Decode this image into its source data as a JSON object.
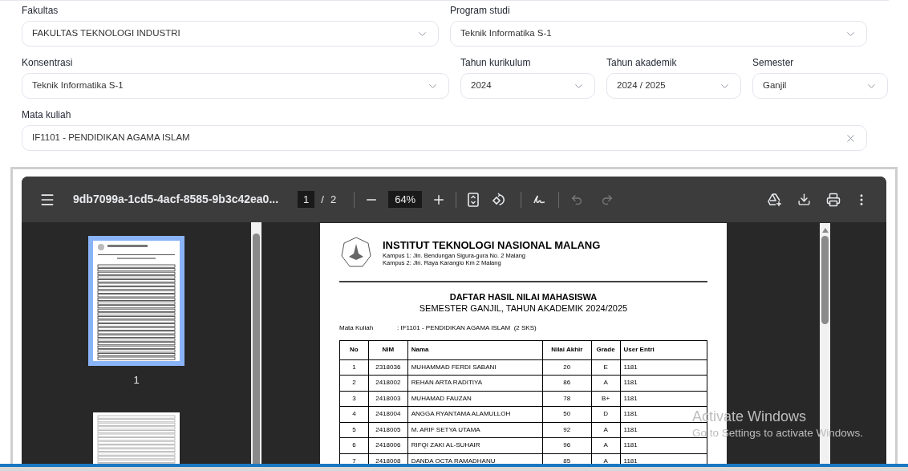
{
  "form": {
    "rows": [
      [
        {
          "label": "Fakultas",
          "value": "FAKULTAS TEKNOLOGI INDUSTRI",
          "kind": "select"
        },
        {
          "label": "Program studi",
          "value": "Teknik Informatika S-1",
          "kind": "select"
        }
      ],
      [
        {
          "label": "Konsentrasi",
          "value": "Teknik Informatika S-1",
          "kind": "select"
        },
        {
          "label": "Tahun kurikulum",
          "value": "2024",
          "kind": "select"
        },
        {
          "label": "Tahun akademik",
          "value": "2024 / 2025",
          "kind": "select"
        },
        {
          "label": "Semester",
          "value": "Ganjil",
          "kind": "select"
        }
      ],
      [
        {
          "label": "Mata kuliah",
          "value": "IF1101 - PENDIDIKAN AGAMA ISLAM",
          "kind": "clearable"
        }
      ]
    ]
  },
  "viewer": {
    "file_name": "9db7099a-1cd5-4acf-8585-9b3c42ea0...",
    "page_input": "1",
    "page_separator": "/",
    "page_total": "2",
    "zoom": "64%",
    "undo_disabled": true,
    "redo_disabled": true,
    "thumbnails": [
      {
        "label": "1",
        "selected": true
      },
      {
        "selected": false
      }
    ]
  },
  "document": {
    "institution": "INSTITUT TEKNOLOGI NASIONAL MALANG",
    "address_lines": [
      "Kampus 1: Jln. Bendungan Sigura-gura No. 2 Malang",
      "Kampus 2: Jln. Raya Karanglo Km 2 Malang"
    ],
    "title": "DAFTAR HASIL NILAI MAHASISWA",
    "subtitle": "SEMESTER GANJIL, TAHUN AKADEMIK 2024/2025",
    "course_label": "Mata Kuliah",
    "course_value": ": IF1101 - PENDIDIKAN AGAMA ISLAM  (2 SKS)",
    "table": {
      "columns": [
        "No",
        "NIM",
        "Nama",
        "Nilai Akhir",
        "Grade",
        "User Entri"
      ],
      "rows": [
        [
          "1",
          "2318036",
          "MUHAMMAD FERDI SABANI",
          "20",
          "E",
          "1181"
        ],
        [
          "2",
          "2418002",
          "REHAN ARTA RADITIYA",
          "86",
          "A",
          "1181"
        ],
        [
          "3",
          "2418003",
          "MUHAMAD FAUZAN",
          "78",
          "B+",
          "1181"
        ],
        [
          "4",
          "2418004",
          "ANGGA RYANTAMA ALAMULLOH",
          "50",
          "D",
          "1181"
        ],
        [
          "5",
          "2418005",
          "M. ARIF SETYA UTAMA",
          "92",
          "A",
          "1181"
        ],
        [
          "6",
          "2418006",
          "RIFQI ZAKI AL-SUHAIR",
          "96",
          "A",
          "1181"
        ],
        [
          "7",
          "2418008",
          "DANDA OCTA RAMADHANU",
          "85",
          "A",
          "1181"
        ]
      ]
    }
  },
  "os_notice": {
    "title": "Activate Windows",
    "text": "Go to Settings to activate Windows."
  }
}
